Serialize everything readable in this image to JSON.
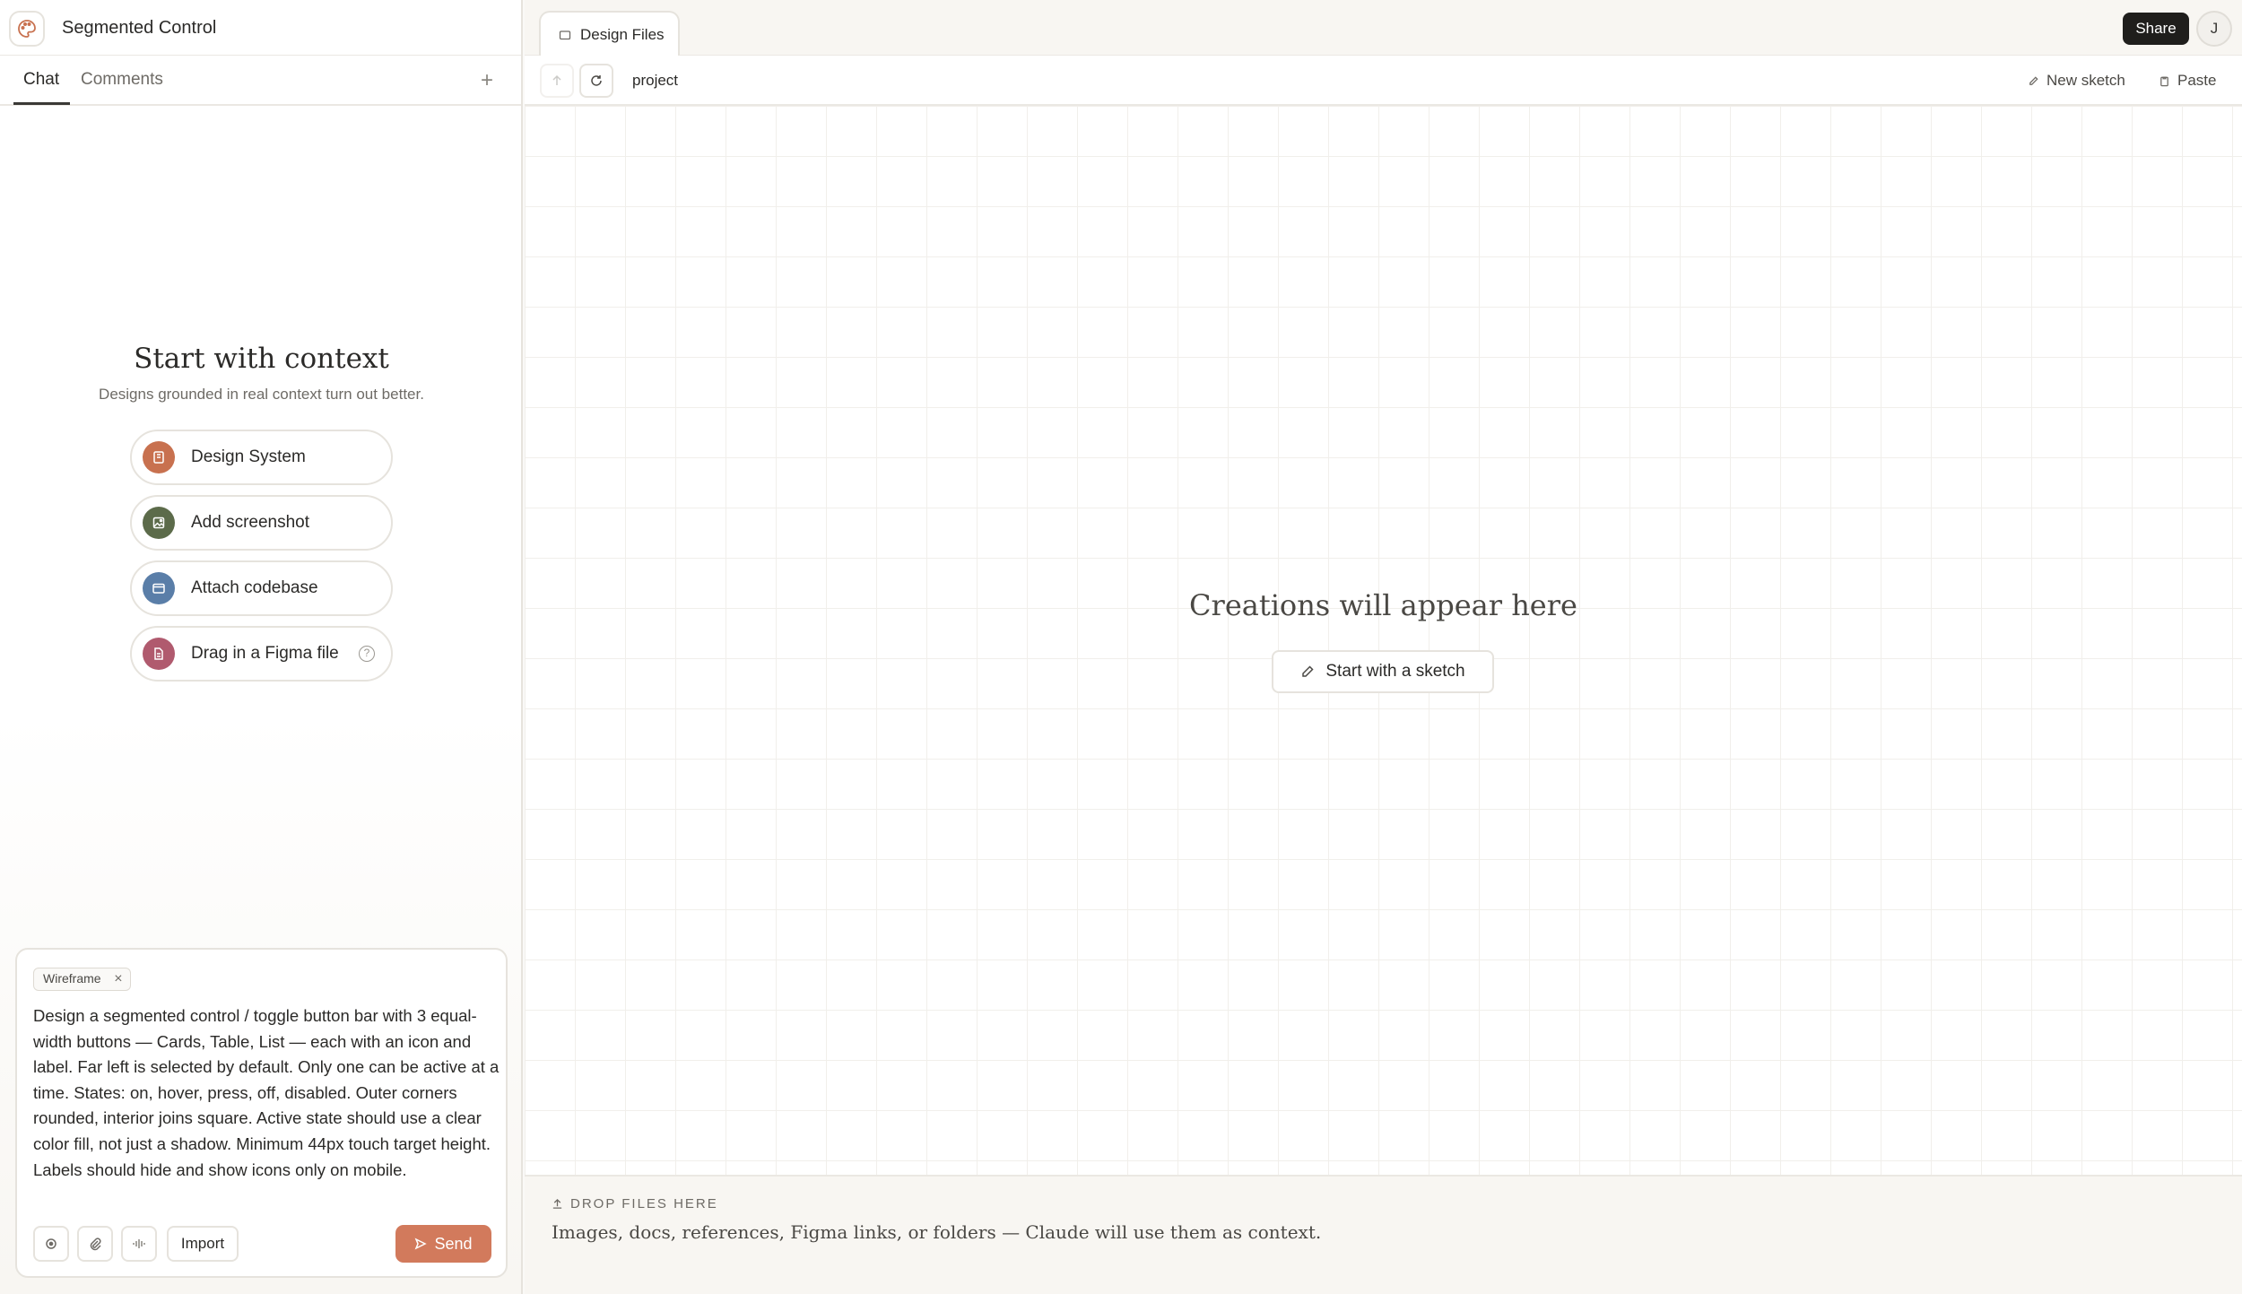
{
  "app": {
    "title": "Segmented Control",
    "icon": "palette-icon"
  },
  "left_tabs": [
    {
      "label": "Chat",
      "active": true
    },
    {
      "label": "Comments",
      "active": false
    }
  ],
  "context": {
    "title": "Start with context",
    "subtitle": "Designs grounded in real context turn out better.",
    "options": [
      {
        "label": "Design System",
        "icon": "book-icon",
        "color": "#c8714f"
      },
      {
        "label": "Add screenshot",
        "icon": "image-icon",
        "color": "#5c6b4a"
      },
      {
        "label": "Attach codebase",
        "icon": "folder-icon",
        "color": "#5a7ea8"
      },
      {
        "label": "Drag in a Figma file",
        "icon": "file-icon",
        "color": "#b05a6e"
      }
    ]
  },
  "composer": {
    "chip": "Wireframe",
    "prompt": "Design a segmented control / toggle button bar with 3 equal-width buttons — Cards, Table, List — each with an icon and label. Far left is selected by default. Only one can be active at a time. States: on, hover, press, off, disabled. Outer corners rounded, interior joins square. Active state should use a clear color fill, not just a shadow. Minimum 44px touch target height. Labels should hide and show icons only on mobile.",
    "import_label": "Import",
    "send_label": "Send",
    "accent": "#d27a5c"
  },
  "topbar": {
    "file_tab": "Design Files",
    "share_label": "Share",
    "avatar_initial": "J"
  },
  "toolbar": {
    "breadcrumb": "project",
    "new_sketch_label": "New sketch",
    "paste_label": "Paste"
  },
  "canvas": {
    "empty_title": "Creations will appear here",
    "sketch_button": "Start with a sketch"
  },
  "dropzone": {
    "label": "DROP FILES HERE",
    "description": "Images, docs, references, Figma links, or folders — Claude will use them as context."
  }
}
